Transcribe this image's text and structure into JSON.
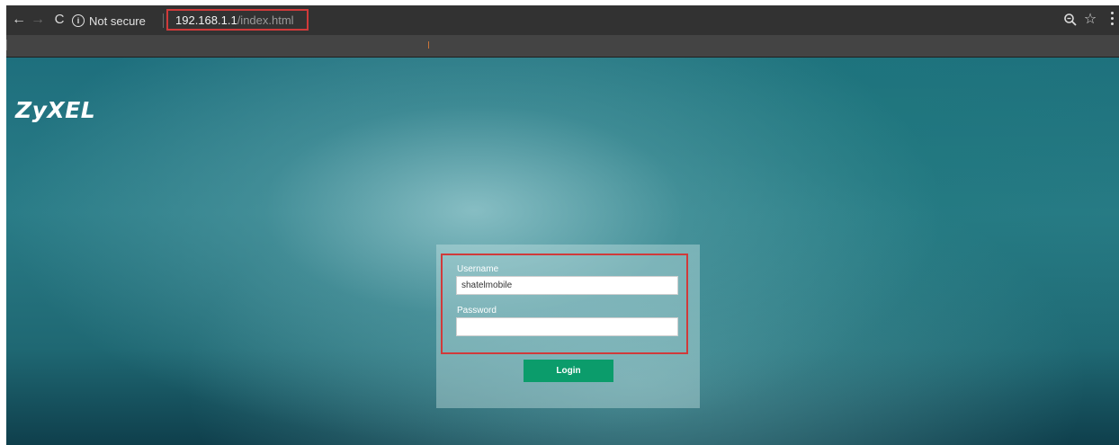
{
  "browser": {
    "back_glyph": "←",
    "forward_glyph": "→",
    "reload_glyph": "C",
    "security_label": "Not secure",
    "info_glyph": "i",
    "url_host": "192.168.1.1",
    "url_path": "/index.html",
    "star_glyph": "☆",
    "icons": {
      "back": "back-arrow-icon",
      "forward": "forward-arrow-icon",
      "reload": "reload-icon",
      "info": "info-icon",
      "zoom": "zoom-icon",
      "bookmark": "star-icon",
      "menu": "kebab-menu-icon"
    }
  },
  "page": {
    "logo_text": "ZyXEL",
    "login": {
      "username_label": "Username",
      "username_value": "shatelmobile",
      "password_label": "Password",
      "password_value": "",
      "login_button": "Login"
    }
  },
  "colors": {
    "highlight": "#d03a3a",
    "login_button": "#0b9c6b",
    "background_teal": "#1e6f7d"
  }
}
